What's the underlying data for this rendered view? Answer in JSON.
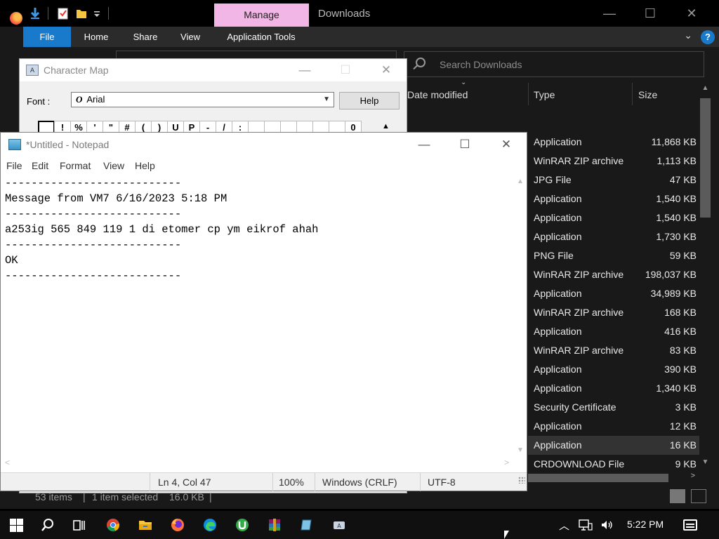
{
  "explorer": {
    "title": "Downloads",
    "manage_tab": "Manage",
    "ribbon_tabs": [
      "File",
      "Home",
      "Share",
      "View",
      "Application Tools"
    ],
    "search_placeholder": "Search Downloads",
    "columns": {
      "date": "Date modified",
      "type": "Type",
      "size": "Size"
    },
    "rows": [
      {
        "type": "Application",
        "size": "11,868 KB"
      },
      {
        "type": "WinRAR ZIP archive",
        "size": "1,113 KB"
      },
      {
        "type": "JPG File",
        "size": "47 KB"
      },
      {
        "type": "Application",
        "size": "1,540 KB"
      },
      {
        "type": "Application",
        "size": "1,540 KB"
      },
      {
        "type": "Application",
        "size": "1,730 KB"
      },
      {
        "type": "PNG File",
        "size": "59 KB"
      },
      {
        "type": "WinRAR ZIP archive",
        "size": "198,037 KB"
      },
      {
        "type": "Application",
        "size": "34,989 KB"
      },
      {
        "type": "WinRAR ZIP archive",
        "size": "168 KB"
      },
      {
        "type": "Application",
        "size": "416 KB"
      },
      {
        "type": "WinRAR ZIP archive",
        "size": "83 KB"
      },
      {
        "type": "Application",
        "size": "390 KB"
      },
      {
        "type": "Application",
        "size": "1,340 KB"
      },
      {
        "type": "Security Certificate",
        "size": "3 KB"
      },
      {
        "type": "Application",
        "size": "12 KB"
      },
      {
        "type": "Application",
        "size": "16 KB"
      },
      {
        "type": "CRDOWNLOAD File",
        "size": "9 KB"
      }
    ],
    "selected_row": 16,
    "status": {
      "items": "53 items",
      "selected": "1 item selected",
      "size": "16.0 KB"
    }
  },
  "charmap": {
    "title": "Character Map",
    "font_label": "Font :",
    "font_value": "Arial",
    "font_icon": "O",
    "help_label": "Help",
    "chars": [
      "",
      "!",
      "%",
      "'",
      "\"",
      "#",
      "(",
      ")",
      "U",
      "P",
      "-",
      "/",
      ":",
      "",
      "",
      "",
      "",
      "",
      "",
      "0"
    ]
  },
  "notepad": {
    "title": "*Untitled - Notepad",
    "menu": [
      "File",
      "Edit",
      "Format",
      "View",
      "Help"
    ],
    "lines": [
      "---------------------------",
      "Message from VM7 6/16/2023 5:18 PM",
      "---------------------------",
      "a253ig 565 849 119 1 di etomer cp ym eikrof ahah",
      "---------------------------",
      "OK",
      "---------------------------"
    ],
    "status": {
      "position": "Ln 4, Col 47",
      "zoom": "100%",
      "line_ending": "Windows (CRLF)",
      "encoding": "UTF-8"
    }
  },
  "taskbar": {
    "apps": [
      "start-icon",
      "search-icon",
      "task-view-icon",
      "chrome-icon",
      "file-explorer-icon",
      "firefox-icon",
      "edge-icon",
      "utorrent-icon",
      "winrar-icon",
      "notepad-icon",
      "character-map-icon"
    ],
    "clock": "5:22 PM"
  },
  "colors": {
    "accent": "#1979ca",
    "manage_tab": "#f2b6e6",
    "explorer_bg": "#191919",
    "taskbar_bg": "#101010"
  }
}
